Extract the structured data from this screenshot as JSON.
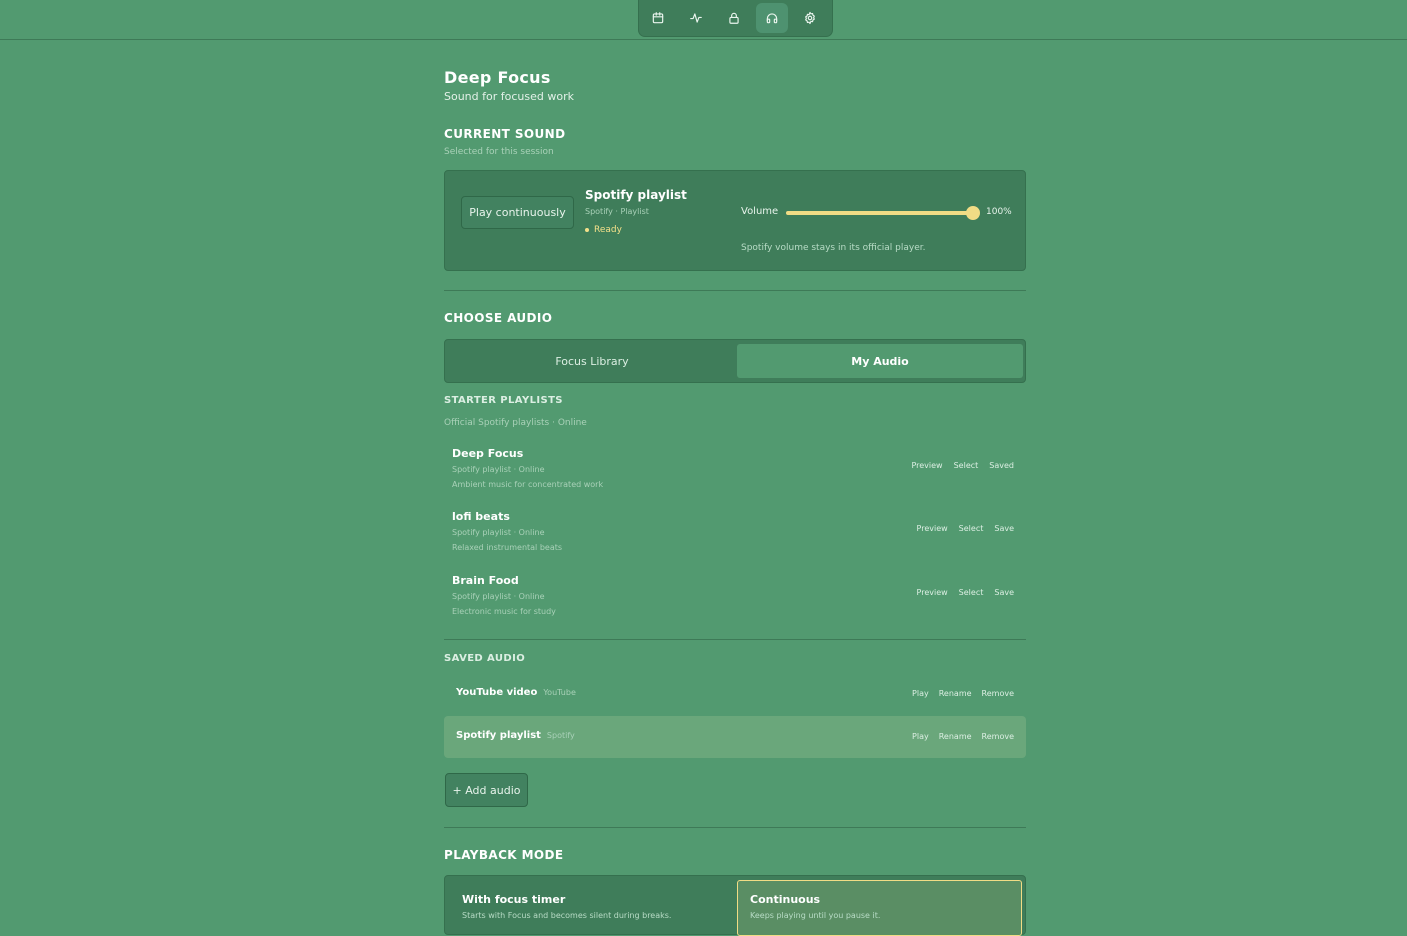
{
  "nav": {
    "icons": [
      "calendar-icon",
      "activity-icon",
      "lock-icon",
      "headphones-icon",
      "gear-icon"
    ],
    "active": "headphones-icon"
  },
  "page": {
    "title": "Deep Focus",
    "subtitle": "Sound for focused work"
  },
  "current_sound": {
    "section_title": "CURRENT SOUND",
    "section_sub": "Selected for this session",
    "play_button": "Play continuously",
    "title": "Spotify playlist",
    "meta": "Spotify · Playlist",
    "status": "Ready",
    "volume_label": "Volume",
    "volume_value": "100%",
    "volume_level": 1.0,
    "volume_note": "Spotify volume stays in its official player."
  },
  "choose_audio": {
    "section_title": "CHOOSE AUDIO",
    "tabs": [
      {
        "label": "Focus Library",
        "active": false
      },
      {
        "label": "My Audio",
        "active": true
      }
    ]
  },
  "starter": {
    "title": "STARTER PLAYLISTS",
    "sub": "Official Spotify playlists · Online",
    "items": [
      {
        "name": "Deep Focus",
        "type": "Spotify playlist · Online",
        "desc": "Ambient music for concentrated work",
        "actions": [
          "Preview",
          "Select",
          "Saved"
        ]
      },
      {
        "name": "lofi beats",
        "type": "Spotify playlist · Online",
        "desc": "Relaxed instrumental beats",
        "actions": [
          "Preview",
          "Select",
          "Save"
        ]
      },
      {
        "name": "Brain Food",
        "type": "Spotify playlist · Online",
        "desc": "Electronic music for study",
        "actions": [
          "Preview",
          "Select",
          "Save"
        ]
      }
    ]
  },
  "saved": {
    "title": "SAVED AUDIO",
    "items": [
      {
        "name": "YouTube video",
        "source": "YouTube",
        "actions": [
          "Play",
          "Rename",
          "Remove"
        ],
        "active": false
      },
      {
        "name": "Spotify playlist",
        "source": "Spotify",
        "actions": [
          "Play",
          "Rename",
          "Remove"
        ],
        "active": true
      }
    ],
    "add_button": "+ Add audio"
  },
  "playback": {
    "section_title": "PLAYBACK MODE",
    "options": [
      {
        "title": "With focus timer",
        "desc": "Starts with Focus and becomes silent during breaks.",
        "active": false
      },
      {
        "title": "Continuous",
        "desc": "Keeps playing until you pause it.",
        "active": true
      }
    ]
  }
}
